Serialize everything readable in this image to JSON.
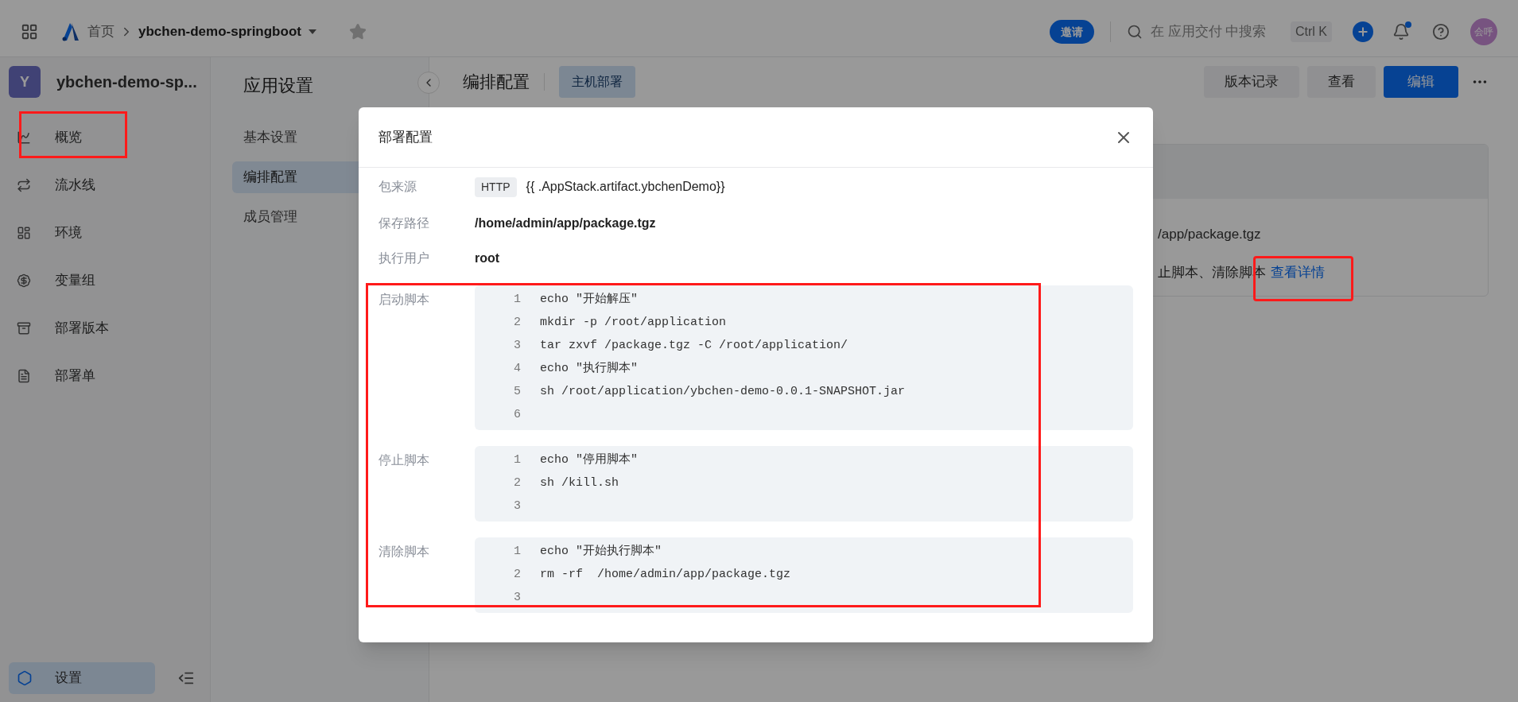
{
  "top_bar": {
    "home": "首页",
    "project": "ybchen-demo-springboot",
    "invite": "邀请",
    "search": {
      "placeholder": "在 应用交付 中搜索",
      "shortcut": "Ctrl K"
    },
    "avatar": "会呼"
  },
  "sidebar": {
    "app_initial": "Y",
    "app_name": "ybchen-demo-sp...",
    "items": [
      {
        "label": "概览",
        "selected": false
      },
      {
        "label": "流水线",
        "selected": false
      },
      {
        "label": "环境",
        "selected": false
      },
      {
        "label": "变量组",
        "selected": false
      },
      {
        "label": "部署版本",
        "selected": false
      },
      {
        "label": "部署单",
        "selected": false
      }
    ],
    "settings": {
      "label": "设置",
      "selected": true
    }
  },
  "settings_nav": {
    "title": "应用设置",
    "items": [
      {
        "label": "基本设置",
        "selected": false
      },
      {
        "label": "编排配置",
        "selected": true
      },
      {
        "label": "成员管理",
        "selected": false
      }
    ]
  },
  "main": {
    "title": "编排配置",
    "tag": "主机部署",
    "buttons": [
      {
        "label": "版本记录",
        "kind": "secondary"
      },
      {
        "label": "查看",
        "kind": "secondary"
      },
      {
        "label": "编辑",
        "kind": "primary"
      }
    ],
    "card": {
      "path": "/app/package.tgz",
      "scripts": "止脚本、清除脚本",
      "link": "查看详情"
    }
  },
  "dialog": {
    "title": "部署配置",
    "fields": [
      {
        "kind": "source",
        "label": "包来源",
        "badge": "HTTP",
        "value": "{{ .AppStack.artifact.ybchenDemo}}"
      },
      {
        "kind": "text",
        "label": "保存路径",
        "value": "/home/admin/app/package.tgz"
      },
      {
        "kind": "text",
        "label": "执行用户",
        "value": "root"
      },
      {
        "kind": "code",
        "label": "启动脚本",
        "lines": [
          {
            "number": "1",
            "code": "echo \"开始解压\""
          },
          {
            "number": "2",
            "code": "mkdir -p /root/application"
          },
          {
            "number": "3",
            "code": "tar zxvf /package.tgz -C /root/application/"
          },
          {
            "number": "4",
            "code": "echo \"执行脚本\""
          },
          {
            "number": "5",
            "code": "sh /root/application/ybchen-demo-0.0.1-SNAPSHOT.jar"
          },
          {
            "number": "6"
          }
        ]
      },
      {
        "kind": "code",
        "label": "停止脚本",
        "lines": [
          {
            "number": "1",
            "code": "echo \"停用脚本\""
          },
          {
            "number": "2",
            "code": "sh /kill.sh"
          },
          {
            "number": "3"
          }
        ]
      },
      {
        "kind": "code",
        "label": "清除脚本",
        "lines": [
          {
            "number": "1",
            "code": "echo \"开始执行脚本\""
          },
          {
            "number": "2",
            "code": "rm -rf  /home/admin/app/package.tgz"
          },
          {
            "number": "3"
          }
        ]
      }
    ]
  }
}
